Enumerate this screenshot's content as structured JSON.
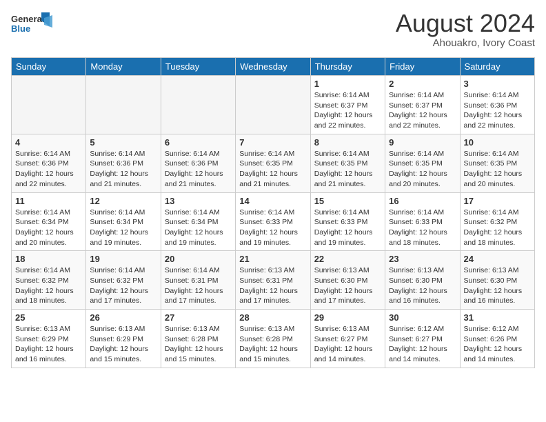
{
  "header": {
    "logo_line1": "General",
    "logo_line2": "Blue",
    "month_year": "August 2024",
    "location": "Ahouakro, Ivory Coast"
  },
  "days_of_week": [
    "Sunday",
    "Monday",
    "Tuesday",
    "Wednesday",
    "Thursday",
    "Friday",
    "Saturday"
  ],
  "weeks": [
    [
      {
        "day": "",
        "info": ""
      },
      {
        "day": "",
        "info": ""
      },
      {
        "day": "",
        "info": ""
      },
      {
        "day": "",
        "info": ""
      },
      {
        "day": "1",
        "info": "Sunrise: 6:14 AM\nSunset: 6:37 PM\nDaylight: 12 hours\nand 22 minutes."
      },
      {
        "day": "2",
        "info": "Sunrise: 6:14 AM\nSunset: 6:37 PM\nDaylight: 12 hours\nand 22 minutes."
      },
      {
        "day": "3",
        "info": "Sunrise: 6:14 AM\nSunset: 6:36 PM\nDaylight: 12 hours\nand 22 minutes."
      }
    ],
    [
      {
        "day": "4",
        "info": "Sunrise: 6:14 AM\nSunset: 6:36 PM\nDaylight: 12 hours\nand 22 minutes."
      },
      {
        "day": "5",
        "info": "Sunrise: 6:14 AM\nSunset: 6:36 PM\nDaylight: 12 hours\nand 21 minutes."
      },
      {
        "day": "6",
        "info": "Sunrise: 6:14 AM\nSunset: 6:36 PM\nDaylight: 12 hours\nand 21 minutes."
      },
      {
        "day": "7",
        "info": "Sunrise: 6:14 AM\nSunset: 6:35 PM\nDaylight: 12 hours\nand 21 minutes."
      },
      {
        "day": "8",
        "info": "Sunrise: 6:14 AM\nSunset: 6:35 PM\nDaylight: 12 hours\nand 21 minutes."
      },
      {
        "day": "9",
        "info": "Sunrise: 6:14 AM\nSunset: 6:35 PM\nDaylight: 12 hours\nand 20 minutes."
      },
      {
        "day": "10",
        "info": "Sunrise: 6:14 AM\nSunset: 6:35 PM\nDaylight: 12 hours\nand 20 minutes."
      }
    ],
    [
      {
        "day": "11",
        "info": "Sunrise: 6:14 AM\nSunset: 6:34 PM\nDaylight: 12 hours\nand 20 minutes."
      },
      {
        "day": "12",
        "info": "Sunrise: 6:14 AM\nSunset: 6:34 PM\nDaylight: 12 hours\nand 19 minutes."
      },
      {
        "day": "13",
        "info": "Sunrise: 6:14 AM\nSunset: 6:34 PM\nDaylight: 12 hours\nand 19 minutes."
      },
      {
        "day": "14",
        "info": "Sunrise: 6:14 AM\nSunset: 6:33 PM\nDaylight: 12 hours\nand 19 minutes."
      },
      {
        "day": "15",
        "info": "Sunrise: 6:14 AM\nSunset: 6:33 PM\nDaylight: 12 hours\nand 19 minutes."
      },
      {
        "day": "16",
        "info": "Sunrise: 6:14 AM\nSunset: 6:33 PM\nDaylight: 12 hours\nand 18 minutes."
      },
      {
        "day": "17",
        "info": "Sunrise: 6:14 AM\nSunset: 6:32 PM\nDaylight: 12 hours\nand 18 minutes."
      }
    ],
    [
      {
        "day": "18",
        "info": "Sunrise: 6:14 AM\nSunset: 6:32 PM\nDaylight: 12 hours\nand 18 minutes."
      },
      {
        "day": "19",
        "info": "Sunrise: 6:14 AM\nSunset: 6:32 PM\nDaylight: 12 hours\nand 17 minutes."
      },
      {
        "day": "20",
        "info": "Sunrise: 6:14 AM\nSunset: 6:31 PM\nDaylight: 12 hours\nand 17 minutes."
      },
      {
        "day": "21",
        "info": "Sunrise: 6:13 AM\nSunset: 6:31 PM\nDaylight: 12 hours\nand 17 minutes."
      },
      {
        "day": "22",
        "info": "Sunrise: 6:13 AM\nSunset: 6:30 PM\nDaylight: 12 hours\nand 17 minutes."
      },
      {
        "day": "23",
        "info": "Sunrise: 6:13 AM\nSunset: 6:30 PM\nDaylight: 12 hours\nand 16 minutes."
      },
      {
        "day": "24",
        "info": "Sunrise: 6:13 AM\nSunset: 6:30 PM\nDaylight: 12 hours\nand 16 minutes."
      }
    ],
    [
      {
        "day": "25",
        "info": "Sunrise: 6:13 AM\nSunset: 6:29 PM\nDaylight: 12 hours\nand 16 minutes."
      },
      {
        "day": "26",
        "info": "Sunrise: 6:13 AM\nSunset: 6:29 PM\nDaylight: 12 hours\nand 15 minutes."
      },
      {
        "day": "27",
        "info": "Sunrise: 6:13 AM\nSunset: 6:28 PM\nDaylight: 12 hours\nand 15 minutes."
      },
      {
        "day": "28",
        "info": "Sunrise: 6:13 AM\nSunset: 6:28 PM\nDaylight: 12 hours\nand 15 minutes."
      },
      {
        "day": "29",
        "info": "Sunrise: 6:13 AM\nSunset: 6:27 PM\nDaylight: 12 hours\nand 14 minutes."
      },
      {
        "day": "30",
        "info": "Sunrise: 6:12 AM\nSunset: 6:27 PM\nDaylight: 12 hours\nand 14 minutes."
      },
      {
        "day": "31",
        "info": "Sunrise: 6:12 AM\nSunset: 6:26 PM\nDaylight: 12 hours\nand 14 minutes."
      }
    ]
  ]
}
